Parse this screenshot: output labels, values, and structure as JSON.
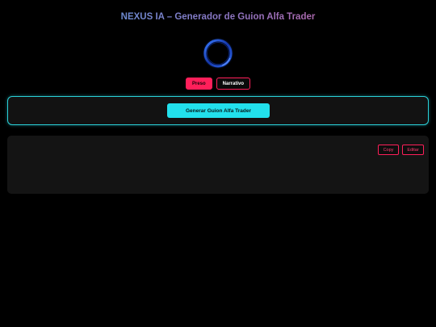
{
  "header": {
    "title": "NEXUS IA – Generador de Guion Alfa Trader"
  },
  "orb": {
    "icon": "loading-ring-icon",
    "color": "#1e5bd6"
  },
  "modes": {
    "items": [
      {
        "label": "Preso",
        "active": true
      },
      {
        "label": "Narrativo",
        "active": false
      }
    ],
    "accent": "#ff1f5a"
  },
  "generator": {
    "button_label": "Generar Guion Alfa Trader",
    "accent": "#22e0ec"
  },
  "output": {
    "text": "",
    "copy_label": "Copy",
    "edit_label": "Editar"
  }
}
